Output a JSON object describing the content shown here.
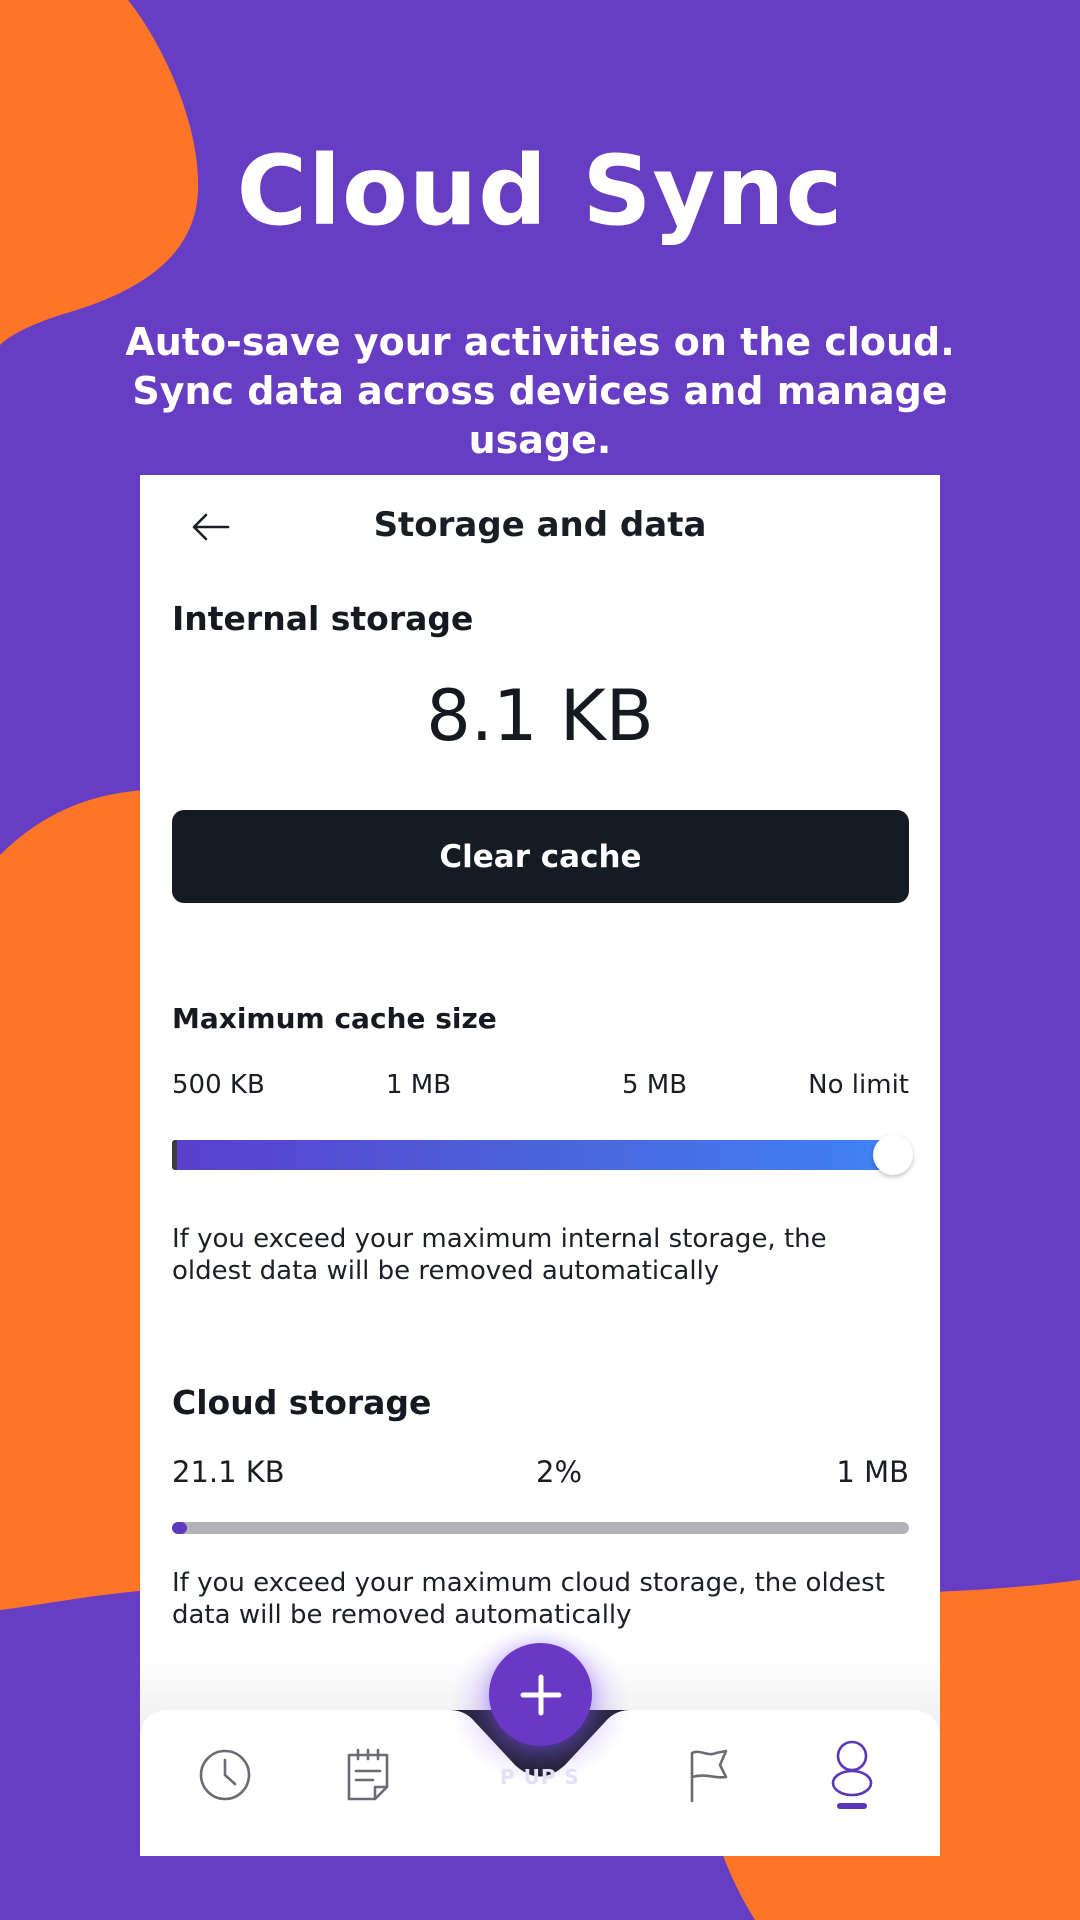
{
  "hero": {
    "title": "Cloud Sync",
    "subtitle": "Auto-save your activities on the cloud. Sync data across devices and manage usage."
  },
  "colors": {
    "background": "#673EC3",
    "accent_orange": "#FF7527",
    "dark_button": "#151B22",
    "slider_start": "#5A3FCD",
    "slider_end": "#3F83F5",
    "fab": "#6A38C4"
  },
  "screen": {
    "title": "Storage and data",
    "back_icon": "arrow-left-icon",
    "internal": {
      "heading": "Internal storage",
      "value": "8.1 KB",
      "clear_button": "Clear cache"
    },
    "cache": {
      "heading": "Maximum cache size",
      "ticks": [
        "500 KB",
        "1 MB",
        "5 MB",
        "No limit"
      ],
      "selected": "No limit",
      "note": "If you exceed your maximum internal storage, the oldest data will be removed automatically"
    },
    "cloud": {
      "heading": "Cloud storage",
      "used": "21.1 KB",
      "percent": "2%",
      "percent_value": 2,
      "limit": "1 MB",
      "note": "If you exceed your maximum cloud storage, the oldest data will be removed automatically"
    }
  },
  "nav": {
    "items": [
      {
        "icon": "clock-icon"
      },
      {
        "icon": "notepad-icon"
      },
      {
        "icon": "flag-icon"
      },
      {
        "icon": "profile-icon",
        "active": true
      }
    ],
    "fab_icon": "plus-icon",
    "fab_label_partial": "P UP S"
  }
}
